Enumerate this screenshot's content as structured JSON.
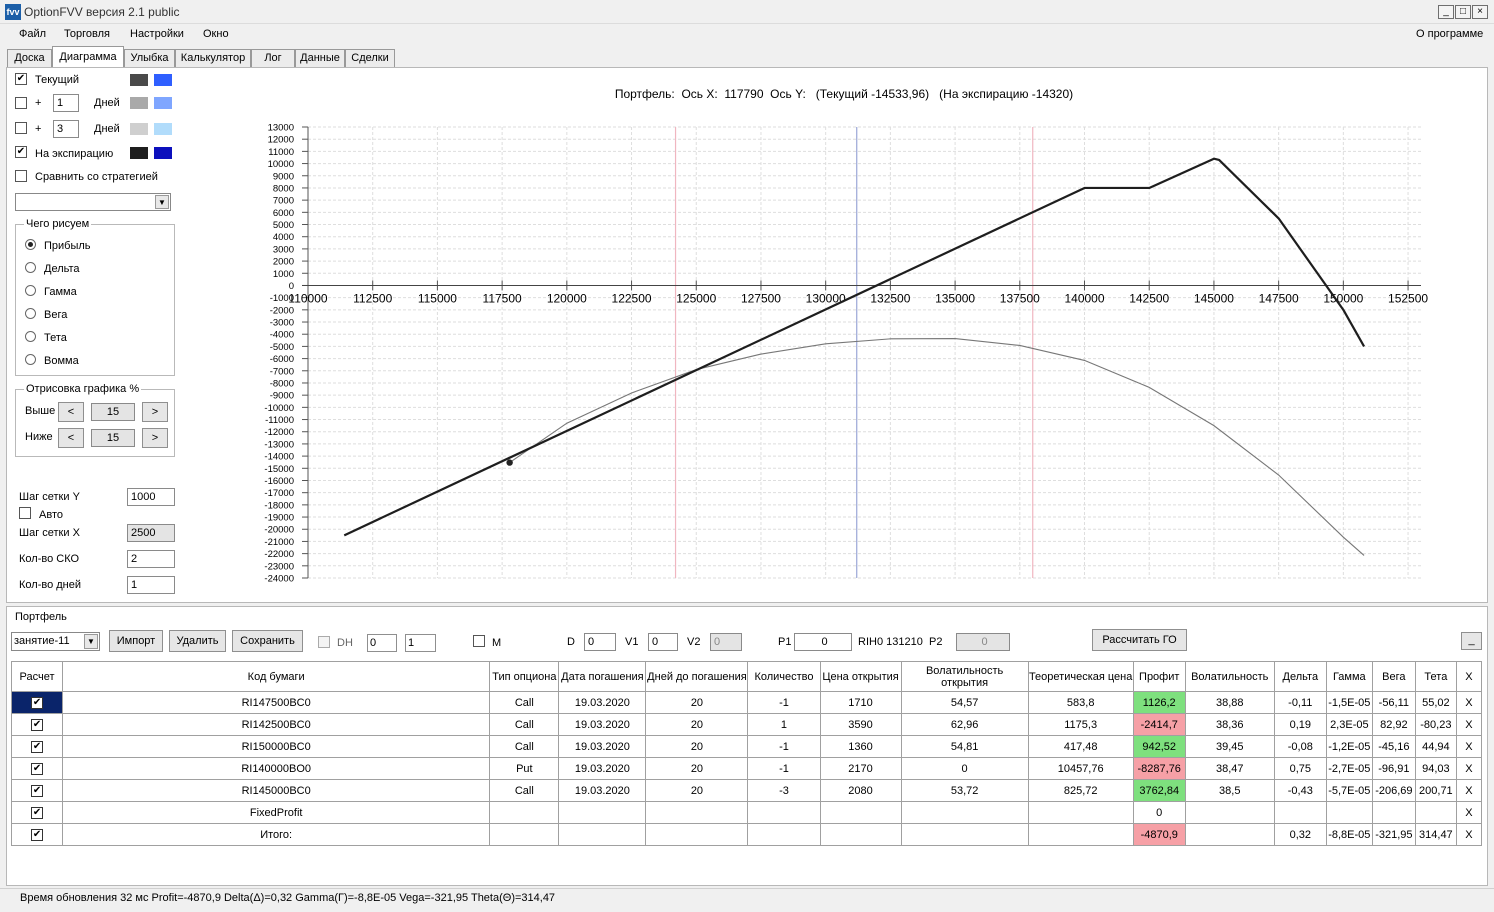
{
  "window": {
    "title": "OptionFVV версия 2.1 public",
    "app_icon": "chart-icon",
    "controls": {
      "minimize": "_",
      "maximize": "□",
      "close": "×"
    }
  },
  "menu": {
    "items": [
      "Файл",
      "Торговля",
      "Настройки",
      "Окно"
    ],
    "about": "О программе"
  },
  "tabs": [
    "Доска",
    "Диаграмма",
    "Улыбка",
    "Калькулятор",
    "Лог",
    "Данные",
    "Сделки"
  ],
  "active_tab": "Диаграмма",
  "left_panel": {
    "current": {
      "label": "Текущий",
      "checked": true,
      "colors": [
        "#4a4a4a",
        "#2f5fff"
      ]
    },
    "plus_rows": [
      {
        "plus": "+",
        "value": "1",
        "unit": "Дней",
        "checked": false,
        "colors": [
          "#a9a9a9",
          "#7fa6ff"
        ]
      },
      {
        "plus": "+",
        "value": "3",
        "unit": "Дней",
        "checked": false,
        "colors": [
          "#cfcfcf",
          "#b1dcfb"
        ]
      }
    ],
    "expiration": {
      "label": "На экспирацию",
      "checked": true,
      "colors": [
        "#1e1e1e",
        "#0c10bd"
      ]
    },
    "compare": {
      "label": "Сравнить со стратегией",
      "checked": false
    },
    "compare_select": "",
    "what_group": {
      "title": "Чего рисуем",
      "options": [
        "Прибыль",
        "Дельта",
        "Гамма",
        "Вега",
        "Тета",
        "Вомма"
      ],
      "selected": "Прибыль"
    },
    "draw_group": {
      "title": "Отрисовка графика %",
      "rows": [
        {
          "label": "Выше",
          "value": "15",
          "dec": "<",
          "inc": ">"
        },
        {
          "label": "Ниже",
          "value": "15",
          "dec": "<",
          "inc": ">"
        }
      ]
    },
    "grid_y": {
      "label": "Шаг сетки Y",
      "value": "1000"
    },
    "auto": {
      "label": "Авто",
      "checked": false
    },
    "grid_x": {
      "label": "Шаг сетки X",
      "value": "2500"
    },
    "sko": {
      "label": "Кол-во СКО",
      "value": "2"
    },
    "days": {
      "label": "Кол-во дней",
      "value": "1"
    }
  },
  "chart_header": "Портфель:  Ось X:  117790  Ось Y:   (Текущий -14533,96)   (На экспирацию -14320)",
  "chart_data": {
    "type": "line",
    "title": "Портфель:  Ось X:  117790  Ось Y:   (Текущий -14533,96)   (На экспирацию -14320)",
    "xlim": [
      110000,
      153000
    ],
    "ylim": [
      -24000,
      13000
    ],
    "x_ticks": [
      110000,
      112500,
      115000,
      117500,
      120000,
      122500,
      125000,
      127500,
      130000,
      132500,
      135000,
      137500,
      140000,
      142500,
      145000,
      147500,
      150000,
      152500
    ],
    "y_ticks": [
      13000,
      12000,
      11000,
      10000,
      9000,
      8000,
      7000,
      6000,
      5000,
      4000,
      3000,
      2000,
      1000,
      0,
      -1000,
      -2000,
      -3000,
      -4000,
      -5000,
      -6000,
      -7000,
      -8000,
      -9000,
      -10000,
      -11000,
      -12000,
      -13000,
      -14000,
      -15000,
      -16000,
      -17000,
      -18000,
      -19000,
      -20000,
      -21000,
      -22000,
      -23000,
      -24000
    ],
    "grid": true,
    "series": [
      {
        "x": [
          111400,
          140000,
          142500,
          145000,
          145200,
          147500,
          150000,
          150800
        ],
        "y": [
          -20500,
          8000,
          8000,
          10400,
          10300,
          5500,
          -2000,
          -5000
        ]
      },
      {
        "x": [
          117790,
          120000,
          122500,
          125000,
          127500,
          130000,
          132500,
          135000,
          137500,
          140000,
          142500,
          145000,
          147500,
          150000,
          150800
        ],
        "y": [
          -14532,
          -11300,
          -8820,
          -6900,
          -5630,
          -4790,
          -4380,
          -4360,
          -4920,
          -6150,
          -8360,
          -11500,
          -15550,
          -20650,
          -22150
        ]
      }
    ],
    "vertical_lines": [
      {
        "x": 124200,
        "color": "#f0b6c0"
      },
      {
        "x": 131200,
        "color": "#9aa6d6"
      },
      {
        "x": 138000,
        "color": "#f0b6c0"
      }
    ],
    "marker": {
      "x": 117790,
      "y": -14533
    }
  },
  "portfolio": {
    "title": "Портфель",
    "select": "занятие-11",
    "buttons": {
      "import": "Импорт",
      "delete": "Удалить",
      "save": "Сохранить",
      "calc_go": "Рассчитать ГО",
      "collapse": "_"
    },
    "dh": {
      "label": "DH",
      "checked": false,
      "spin1": "0",
      "spin2": "1"
    },
    "m": {
      "label": "M",
      "checked": false
    },
    "fields": {
      "d": "D",
      "d_val": "0",
      "v1": "V1",
      "v1_val": "0",
      "v2": "V2",
      "v2_val": "0",
      "p1": "P1",
      "p1_val": "0",
      "rih": "RIH0 131210",
      "p2": "P2",
      "p2_val": "0"
    }
  },
  "table": {
    "headers": [
      "Расчет",
      "Код бумаги",
      "Тип опциона",
      "Дата погашения",
      "Дней до погашения",
      "Количество",
      "Цена открытия",
      "Волатильность открытия",
      "Теоретическая цена",
      "Профит",
      "Волатильность",
      "Дельта",
      "Гамма",
      "Вега",
      "Тета",
      "X"
    ],
    "rows": [
      {
        "code": "RI147500BC0",
        "type": "Call",
        "date": "19.03.2020",
        "days": "20",
        "qty": "-1",
        "price": "1710",
        "vol_open": "54,57",
        "theo": "583,8",
        "profit": "1126,2",
        "profit_sign": "pos",
        "vol": "38,88",
        "delta": "-0,11",
        "gamma": "-1,5E-05",
        "vega": "-56,11",
        "theta": "55,02"
      },
      {
        "code": "RI142500BC0",
        "type": "Call",
        "date": "19.03.2020",
        "days": "20",
        "qty": "1",
        "price": "3590",
        "vol_open": "62,96",
        "theo": "1175,3",
        "profit": "-2414,7",
        "profit_sign": "neg",
        "vol": "38,36",
        "delta": "0,19",
        "gamma": "2,3E-05",
        "vega": "82,92",
        "theta": "-80,23"
      },
      {
        "code": "RI150000BC0",
        "type": "Call",
        "date": "19.03.2020",
        "days": "20",
        "qty": "-1",
        "price": "1360",
        "vol_open": "54,81",
        "theo": "417,48",
        "profit": "942,52",
        "profit_sign": "pos",
        "vol": "39,45",
        "delta": "-0,08",
        "gamma": "-1,2E-05",
        "vega": "-45,16",
        "theta": "44,94"
      },
      {
        "code": "RI140000BO0",
        "type": "Put",
        "date": "19.03.2020",
        "days": "20",
        "qty": "-1",
        "price": "2170",
        "vol_open": "0",
        "theo": "10457,76",
        "profit": "-8287,76",
        "profit_sign": "neg",
        "vol": "38,47",
        "delta": "0,75",
        "gamma": "-2,7E-05",
        "vega": "-96,91",
        "theta": "94,03"
      },
      {
        "code": "RI145000BC0",
        "type": "Call",
        "date": "19.03.2020",
        "days": "20",
        "qty": "-3",
        "price": "2080",
        "vol_open": "53,72",
        "theo": "825,72",
        "profit": "3762,84",
        "profit_sign": "pos",
        "vol": "38,5",
        "delta": "-0,43",
        "gamma": "-5,7E-05",
        "vega": "-206,69",
        "theta": "200,71"
      },
      {
        "code": "FixedProfit",
        "type": "",
        "date": "",
        "days": "",
        "qty": "",
        "price": "",
        "vol_open": "",
        "theo": "",
        "profit": "0",
        "profit_sign": "none",
        "vol": "",
        "delta": "",
        "gamma": "",
        "vega": "",
        "theta": ""
      },
      {
        "code": "Итого:",
        "type": "",
        "date": "",
        "days": "",
        "qty": "",
        "price": "",
        "vol_open": "",
        "theo": "",
        "profit": "-4870,9",
        "profit_sign": "neg",
        "vol": "",
        "delta": "0,32",
        "gamma": "-8,8E-05",
        "vega": "-321,95",
        "theta": "314,47"
      }
    ],
    "remove_glyph": "X",
    "check_glyph": "✔"
  },
  "status": "Время обновления 32 мс  Profit=-4870,9 Delta(Δ)=0,32 Gamma(Г)=-8,8E-05 Vega=-321,95 Theta(Θ)=314,47"
}
